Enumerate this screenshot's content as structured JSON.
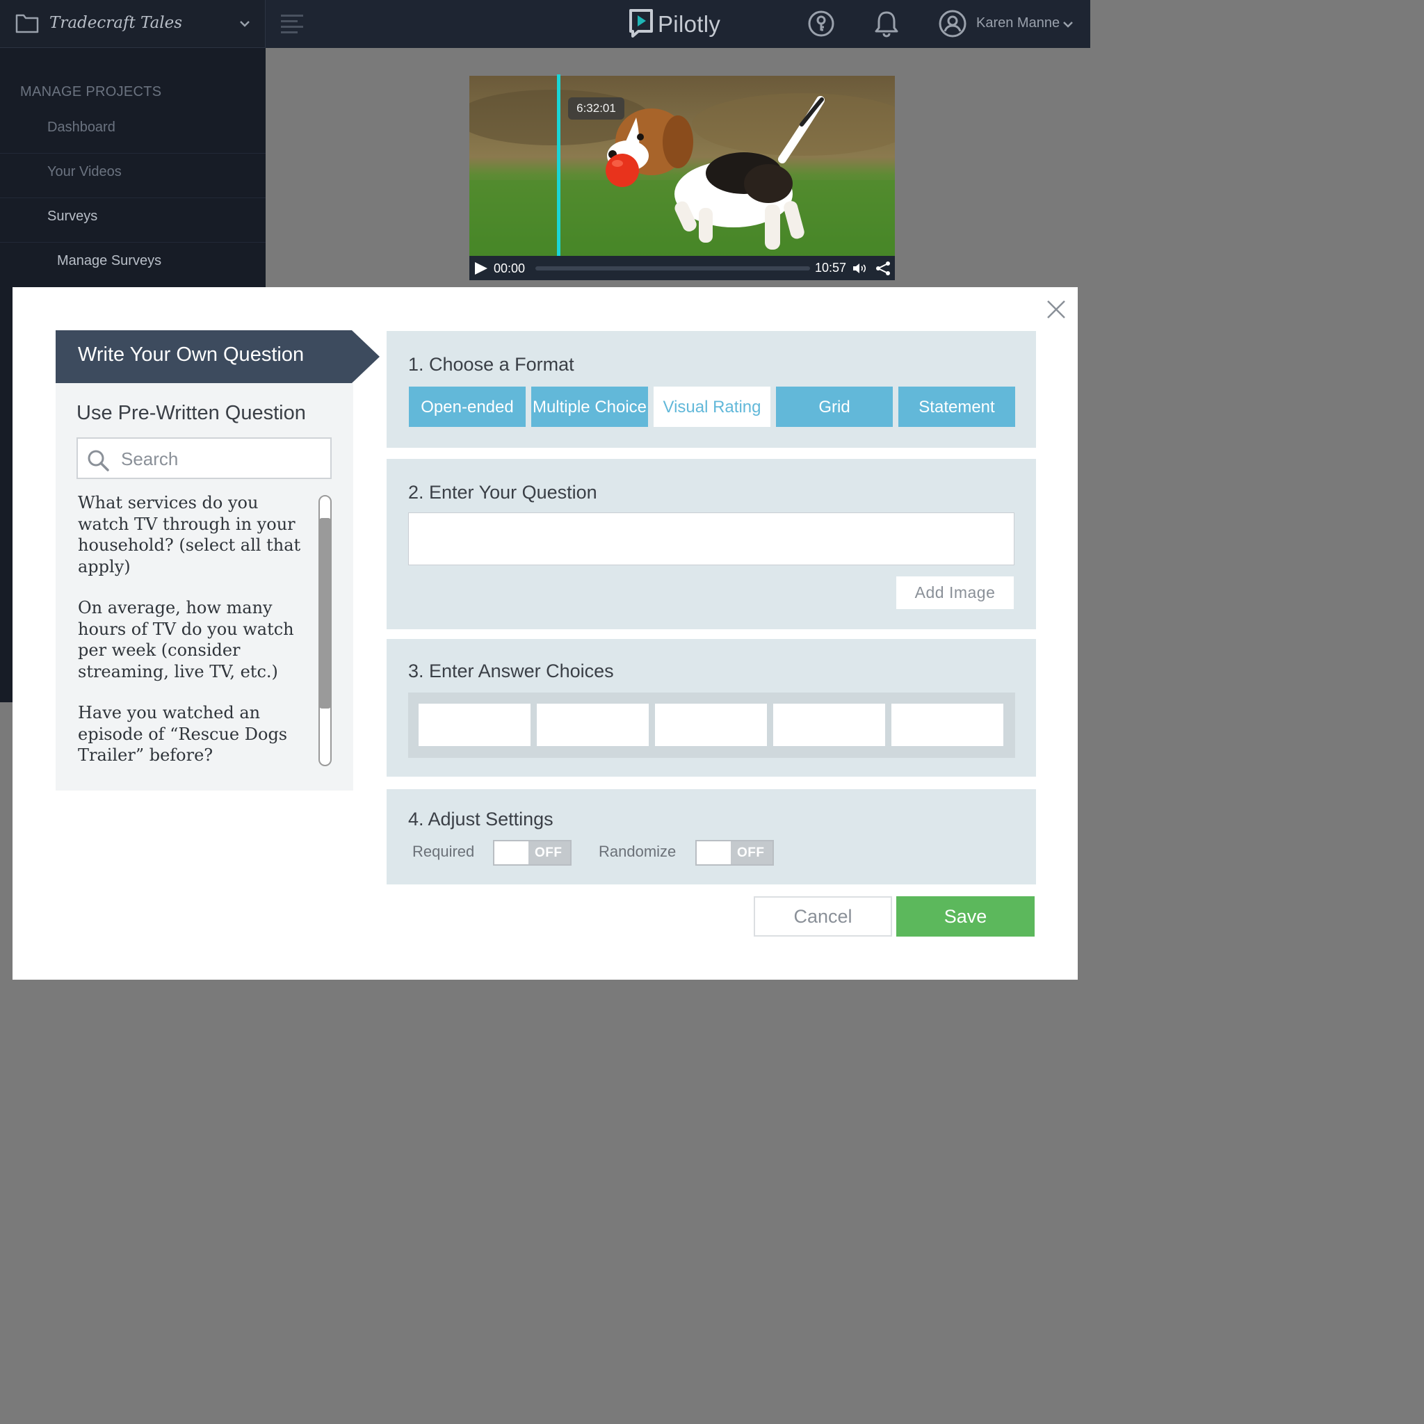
{
  "header": {
    "project_name": "Tradecraft Tales",
    "logo_text": "Pilotly",
    "user_name": "Karen Manne",
    "icons": [
      "folder-icon",
      "chevron-down-icon",
      "hamburger-menu-icon",
      "help-key-icon",
      "bell-icon",
      "user-avatar-icon"
    ]
  },
  "sidebar": {
    "heading": "MANAGE PROJECTS",
    "items": [
      {
        "label": "Dashboard"
      },
      {
        "label": "Your Videos"
      },
      {
        "label": "Surveys"
      },
      {
        "label": "Manage Surveys"
      }
    ]
  },
  "video": {
    "marker_time": "6:32:01",
    "current_time": "00:00",
    "duration": "10:57",
    "icons": [
      "play-icon",
      "volume-icon",
      "share-icon"
    ]
  },
  "modal": {
    "tab_write": "Write Your Own Question",
    "prewritten_title": "Use Pre-Written Question",
    "search_placeholder": "Search",
    "questions": [
      "What services do you watch TV through in your household? (select all that apply)",
      "On average, how many hours of TV do you watch per week (consider streaming, live TV, etc.)",
      "Have you watched an episode of “Rescue Dogs Trailer” before?"
    ],
    "step1_title": "1. Choose a Format",
    "formats": [
      "Open-ended",
      "Multiple Choice",
      "Visual Rating",
      "Grid",
      "Statement"
    ],
    "selected_format": "Visual Rating",
    "step2_title": "2. Enter Your Question",
    "question_value": "",
    "add_image_label": "Add  Image",
    "step3_title": "3. Enter Answer Choices",
    "answer_choices": [
      "",
      "",
      "",
      "",
      ""
    ],
    "step4_title": "4. Adjust Settings",
    "required_label": "Required",
    "required_state": "OFF",
    "randomize_label": "Randomize",
    "randomize_state": "OFF",
    "cancel_label": "Cancel",
    "save_label": "Save"
  },
  "colors": {
    "topbar": "#1e2532",
    "sidebar": "#171c26",
    "accent_blue": "#62b8d9",
    "section_bg": "#dde7eb",
    "save_green": "#5cb85c",
    "playhead": "#1ad6d6",
    "tab_dark": "#3d4b5e"
  }
}
